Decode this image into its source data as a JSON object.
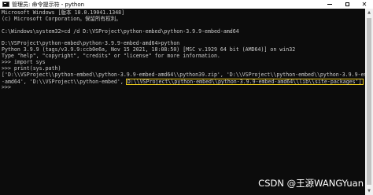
{
  "window": {
    "title": "管理员: 命令提示符 - python",
    "minimize_label": "—",
    "close_label": "✕"
  },
  "console": {
    "lines": [
      "Microsoft Windows [版本 10.0.19041.1348]",
      "(c) Microsoft Corporation。保留所有权利。",
      "",
      "C:\\Windows\\system32>cd /d D:\\VSProject\\python-embed\\python-3.9.9-embed-amd64",
      "",
      "D:\\VSProject\\python-embed\\python-3.9.9-embed-amd64>python",
      "Python 3.9.9 (tags/v3.9.9:ccb0e6a, Nov 15 2021, 18:08:50) [MSC v.1929 64 bit (AMD64)] on win32",
      "Type \"help\", \"copyright\", \"credits\" or \"license\" for more information.",
      ">>> import sys",
      ">>> print(sys.path)",
      "['D:\\\\VSProject\\\\python-embed\\\\python-3.9.9-embed-amd64\\\\python39.zip', 'D:\\\\VSProject\\\\python-embed\\\\python-3.9.9-embed",
      "-amd64', 'D:\\\\VSProject\\\\python-embed',",
      ">>>"
    ],
    "highlighted": "D:\\\\VSProject\\\\python-embed\\\\python-3.9.9-embed-amd64\\\\lib\\\\site-packages']",
    "cursor": "_"
  },
  "watermark": "CSDN @王源WANGYuan",
  "colors": {
    "background": "#0c0c0c",
    "text": "#cccccc",
    "highlight_border": "#e6c619",
    "titlebar": "#ffffff"
  },
  "icons": {
    "app": "cmd-icon"
  }
}
